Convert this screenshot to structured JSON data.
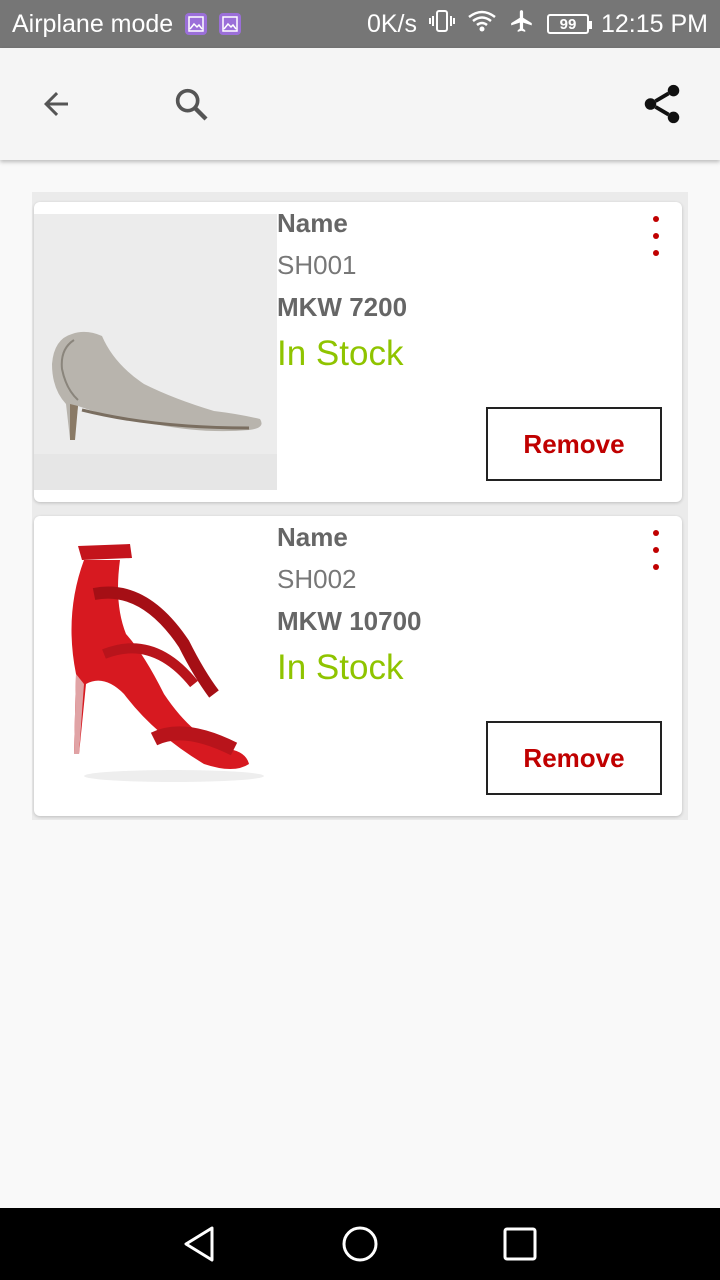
{
  "status_bar": {
    "mode": "Airplane mode",
    "speed": "0K/s",
    "battery": "99",
    "time": "12:15 PM"
  },
  "app_bar": {
    "icons": [
      "back-arrow-icon",
      "search-icon",
      "share-icon"
    ]
  },
  "items": [
    {
      "name_label": "Name",
      "code": "SH001",
      "price": "MKW 7200",
      "stock": "In Stock",
      "remove_label": "Remove",
      "image": "silver-pump-shoe"
    },
    {
      "name_label": "Name",
      "code": "SH002",
      "price": "MKW 10700",
      "stock": "In Stock",
      "remove_label": "Remove",
      "image": "red-strappy-sandal"
    }
  ],
  "colors": {
    "accent": "#c00000",
    "stock_green": "#8fc400",
    "status_bar": "#767676",
    "app_bar": "#f5f5f5"
  }
}
